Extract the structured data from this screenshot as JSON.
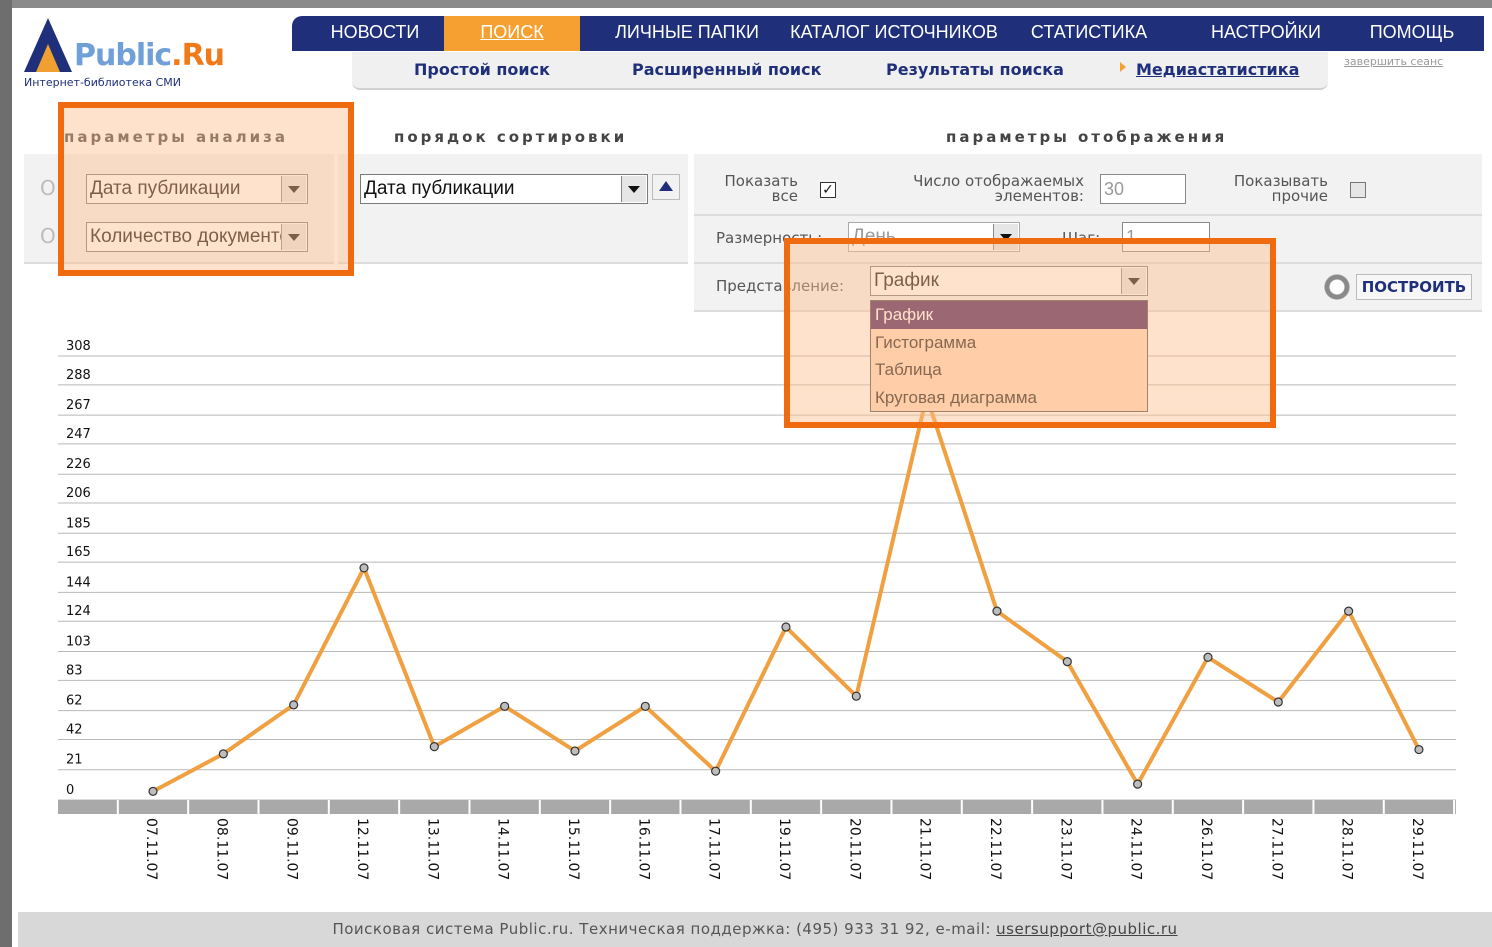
{
  "logo": {
    "name_main": "Public",
    "name_suffix": ".Ru",
    "subtitle": "Интернет-библиотека СМИ"
  },
  "topnav": [
    {
      "label": "НОВОСТИ",
      "active": false
    },
    {
      "label": "ПОИСК",
      "active": true
    },
    {
      "label": "ЛИЧНЫЕ ПАПКИ",
      "active": false
    },
    {
      "label": "КАТАЛОГ ИСТОЧНИКОВ",
      "active": false
    },
    {
      "label": "СТАТИСТИКА",
      "active": false
    },
    {
      "label": "НАСТРОЙКИ",
      "active": false
    },
    {
      "label": "ПОМОЩЬ",
      "active": false
    }
  ],
  "subnav": [
    {
      "label": "Простой поиск"
    },
    {
      "label": "Расширенный поиск"
    },
    {
      "label": "Результаты поиска"
    },
    {
      "label": "Медиастатистика",
      "active": true
    }
  ],
  "logout_label": "завершить сеанс",
  "analysis": {
    "title": "параметры анализа",
    "x_axis_value": "Дата публикации",
    "y_axis_value": "Количество документов",
    "x_letter": "O",
    "y_letter": "O"
  },
  "sorting": {
    "title": "порядок сортировки",
    "value": "Дата публикации"
  },
  "display": {
    "title": "параметры отображения",
    "show_all_label": "Показать все",
    "show_all_checked": true,
    "count_label": "Число отображаемых элементов:",
    "count_value": "30",
    "show_other_label": "Показывать прочие",
    "show_other_checked": false,
    "dimension_label": "Размерность:",
    "dimension_value": "День",
    "step_label": "Шаг:",
    "step_value": "1",
    "view_label": "Представление:",
    "view_value": "График",
    "view_options": [
      "График",
      "Гистограмма",
      "Таблица",
      "Круговая диаграмма"
    ],
    "build_label": "ПОСТРОИТЬ"
  },
  "colors": {
    "nav": "#1f2f7a",
    "accent": "#f5a030",
    "line": "#f0a040",
    "highlight": "#f06a10"
  },
  "chart_data": {
    "type": "line",
    "categories": [
      "07.11.07",
      "08.11.07",
      "09.11.07",
      "12.11.07",
      "13.11.07",
      "14.11.07",
      "15.11.07",
      "16.11.07",
      "17.11.07",
      "19.11.07",
      "20.11.07",
      "21.11.07",
      "22.11.07",
      "23.11.07",
      "24.11.07",
      "26.11.07",
      "27.11.07",
      "28.11.07",
      "29.11.07"
    ],
    "values": [
      6,
      32,
      66,
      161,
      37,
      65,
      34,
      65,
      20,
      120,
      72,
      280,
      131,
      96,
      11,
      99,
      68,
      131,
      35
    ],
    "ytick_labels": [
      "0",
      "21",
      "42",
      "62",
      "83",
      "103",
      "124",
      "144",
      "165",
      "185",
      "206",
      "226",
      "247",
      "267",
      "288",
      "308"
    ],
    "ylim": [
      0,
      308
    ],
    "grid": true
  },
  "footer": {
    "text": "Поисковая система Public.ru. Техническая поддержка: (495) 933 31 92, e-mail:",
    "email": "usersupport@public.ru"
  }
}
